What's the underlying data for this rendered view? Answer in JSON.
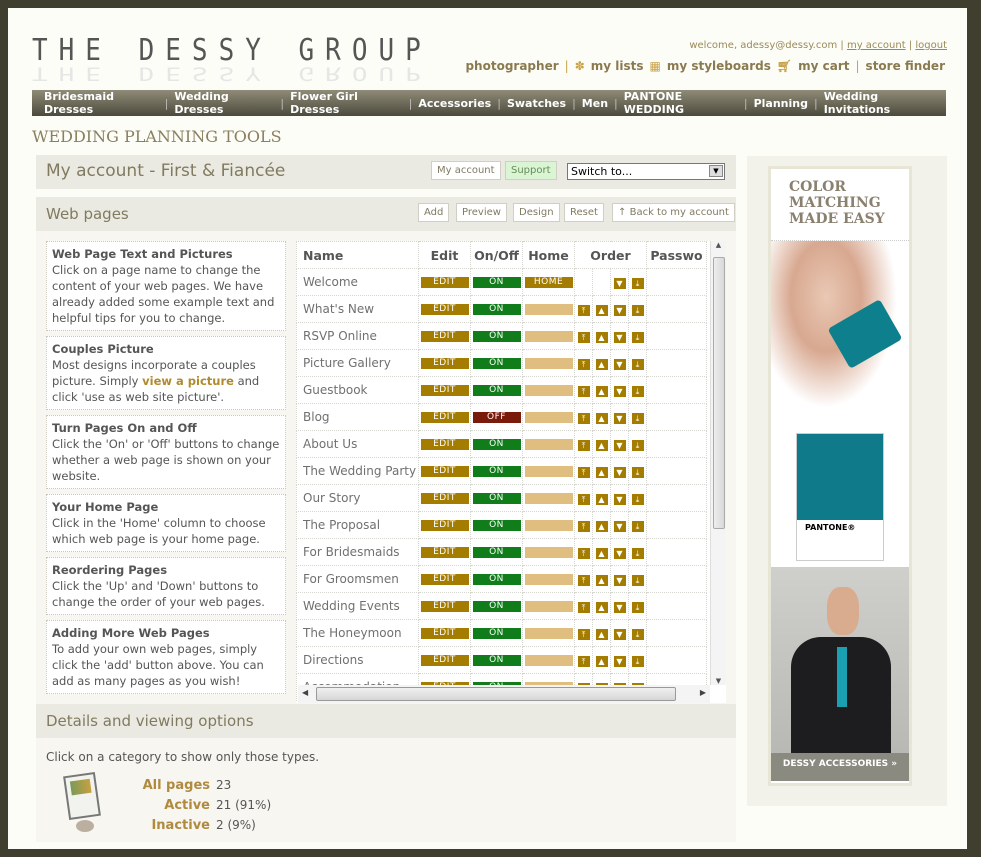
{
  "brand": {
    "logo": "THE DESSY GROUP"
  },
  "top_links": {
    "welcome": "welcome, adessy@dessy.com",
    "my_account": "my account",
    "logout": "logout"
  },
  "util_nav": {
    "photographer": "photographer",
    "my_lists": "my lists",
    "my_styleboards": "my styleboards",
    "my_cart": "my cart",
    "store_finder": "store finder"
  },
  "main_nav": [
    "Bridesmaid Dresses",
    "Wedding Dresses",
    "Flower Girl Dresses",
    "Accessories",
    "Swatches",
    "Men",
    "PANTONE WEDDING",
    "Planning",
    "Wedding Invitations"
  ],
  "page_title": "WEDDING PLANNING TOOLS",
  "account_bar": {
    "title": "My account - First & Fiancée",
    "my_account": "My account",
    "support": "Support",
    "switch_to": "Switch to..."
  },
  "webpages_bar": {
    "title": "Web pages",
    "add": "Add",
    "preview": "Preview",
    "design": "Design",
    "reset": "Reset",
    "back": "Back to my account"
  },
  "help": [
    {
      "title": "Web Page Text and Pictures",
      "text": "Click on a page name to change the content of your web pages. We have already added some example text and helpful tips for you to change."
    },
    {
      "title": "Couples Picture",
      "pre": "Most designs incorporate a couples picture. Simply ",
      "link": "view a picture",
      "post": " and click 'use as web site picture'."
    },
    {
      "title": "Turn Pages On and Off",
      "text": "Click the 'On' or 'Off' buttons to change whether a web page is shown on your website."
    },
    {
      "title": "Your Home Page",
      "text": "Click in the 'Home' column to choose which web page is your home page."
    },
    {
      "title": "Reordering Pages",
      "text": "Click the 'Up' and 'Down' buttons to change the order of your web pages."
    },
    {
      "title": "Adding More Web Pages",
      "text": "To add your own web pages, simply click the 'add' button above. You can add as many pages as you wish!"
    }
  ],
  "table": {
    "headers": [
      "Name",
      "Edit",
      "On/Off",
      "Home",
      "Order",
      "Passwo"
    ],
    "edit_label": "EDIT",
    "on_label": "ON",
    "off_label": "OFF",
    "home_label": "HOME",
    "rows": [
      {
        "name": "Welcome",
        "on": true,
        "home": true
      },
      {
        "name": "What's New",
        "on": true
      },
      {
        "name": "RSVP Online",
        "on": true
      },
      {
        "name": "Picture Gallery",
        "on": true
      },
      {
        "name": "Guestbook",
        "on": true
      },
      {
        "name": "Blog",
        "on": false
      },
      {
        "name": "About Us",
        "on": true
      },
      {
        "name": "The Wedding Party",
        "on": true
      },
      {
        "name": "Our Story",
        "on": true
      },
      {
        "name": "The Proposal",
        "on": true
      },
      {
        "name": "For Bridesmaids",
        "on": true
      },
      {
        "name": "For Groomsmen",
        "on": true
      },
      {
        "name": "Wedding Events",
        "on": true
      },
      {
        "name": "The Honeymoon",
        "on": true
      },
      {
        "name": "Directions",
        "on": true
      },
      {
        "name": "Accommodation",
        "on": true
      }
    ]
  },
  "details": {
    "title": "Details and viewing options",
    "hint": "Click on a category to show only those types.",
    "stats": [
      {
        "label": "All pages",
        "value": "23"
      },
      {
        "label": "Active",
        "value": "21 (91%)"
      },
      {
        "label": "Inactive",
        "value": "2 (9%)"
      }
    ]
  },
  "ad": {
    "headline": "COLOR MATCHING MADE EASY",
    "pantone": "PANTONE®",
    "cta": "DESSY ACCESSORIES »",
    "swatch_color": "#0f7a8a"
  }
}
